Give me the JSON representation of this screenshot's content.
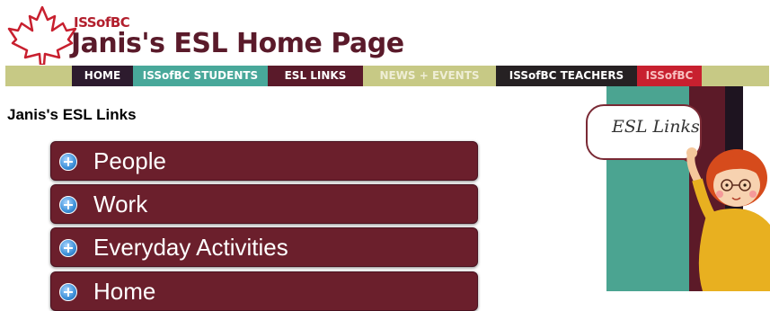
{
  "header": {
    "logo_small": "ISSofBC",
    "title": "Janis's ESL Home Page"
  },
  "nav": [
    {
      "label": "HOME"
    },
    {
      "label": "ISSofBC STUDENTS"
    },
    {
      "label": "ESL LINKS"
    },
    {
      "label": "NEWS + EVENTS"
    },
    {
      "label": "ISSofBC TEACHERS"
    },
    {
      "label": "ISSofBC"
    }
  ],
  "main": {
    "heading": "Janis's ESL Links",
    "items": [
      {
        "label": "People",
        "icon": "plus-icon"
      },
      {
        "label": "Work",
        "icon": "plus-icon"
      },
      {
        "label": "Everyday Activities",
        "icon": "plus-icon"
      },
      {
        "label": "Home",
        "icon": "plus-icon"
      }
    ]
  },
  "sidebar": {
    "bubble_text": "ESL Links"
  },
  "colors": {
    "maroon": "#6b1f2c",
    "teal": "#48a89a",
    "olive": "#c7c985",
    "red": "#c8202f"
  }
}
